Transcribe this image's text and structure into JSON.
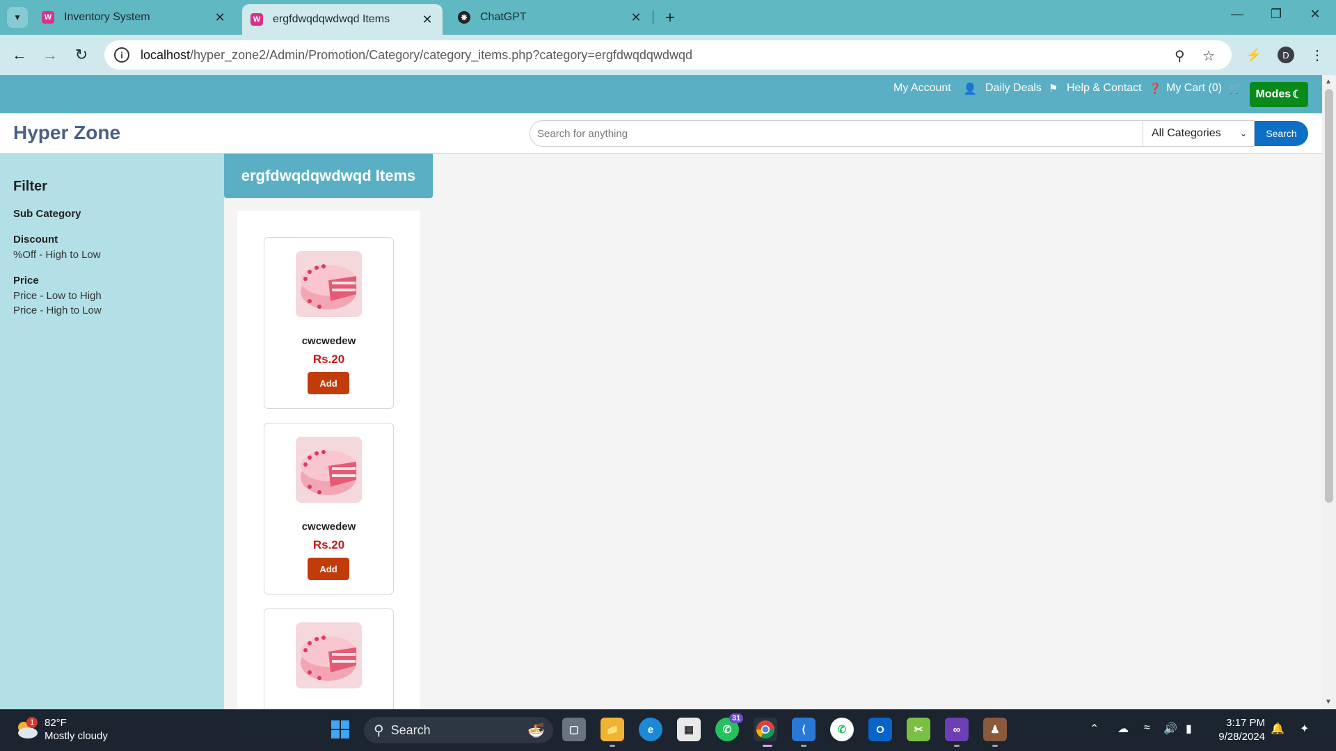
{
  "browser": {
    "tabs": [
      {
        "title": "Inventory System",
        "active": false
      },
      {
        "title": "ergfdwqdqwdwqd Items",
        "active": true
      },
      {
        "title": "ChatGPT",
        "active": false
      }
    ],
    "url_host": "localhost",
    "url_path": "/hyper_zone2/Admin/Promotion/Category/category_items.php?category=ergfdwqdqwdwqd",
    "profile_initial": "D"
  },
  "topnav": {
    "my_account": "My Account",
    "daily_deals": "Daily Deals",
    "help_contact": "Help & Contact",
    "my_cart": "My Cart (0)",
    "modes": "Modes"
  },
  "header": {
    "brand": "Hyper Zone",
    "search_placeholder": "Search for anything",
    "category_selected": "All Categories",
    "search_button": "Search"
  },
  "filter": {
    "title": "Filter",
    "sub_category": "Sub Category",
    "discount": "Discount",
    "discount_option": "%Off - High to Low",
    "price": "Price",
    "price_low_high": "Price - Low to High",
    "price_high_low": "Price - High to Low"
  },
  "main": {
    "heading": "ergfdwqdqwdwqd Items",
    "items": [
      {
        "name": "cwcwedew",
        "price": "Rs.20",
        "button": "Add"
      },
      {
        "name": "cwcwedew",
        "price": "Rs.20",
        "button": "Add"
      },
      {
        "name": "",
        "price": "",
        "button": ""
      }
    ]
  },
  "taskbar": {
    "weather_temp": "82°F",
    "weather_desc": "Mostly cloudy",
    "weather_badge": "1",
    "search_label": "Search",
    "whatsapp_badge": "31",
    "time": "3:17 PM",
    "date": "9/28/2024"
  },
  "colors": {
    "nav_bg": "#5aafc4",
    "sidebar_bg": "#b2e0e6",
    "modes_btn": "#0a8a1a",
    "search_btn": "#0d6fc6",
    "add_btn": "#c23c0a",
    "price": "#c41818"
  }
}
